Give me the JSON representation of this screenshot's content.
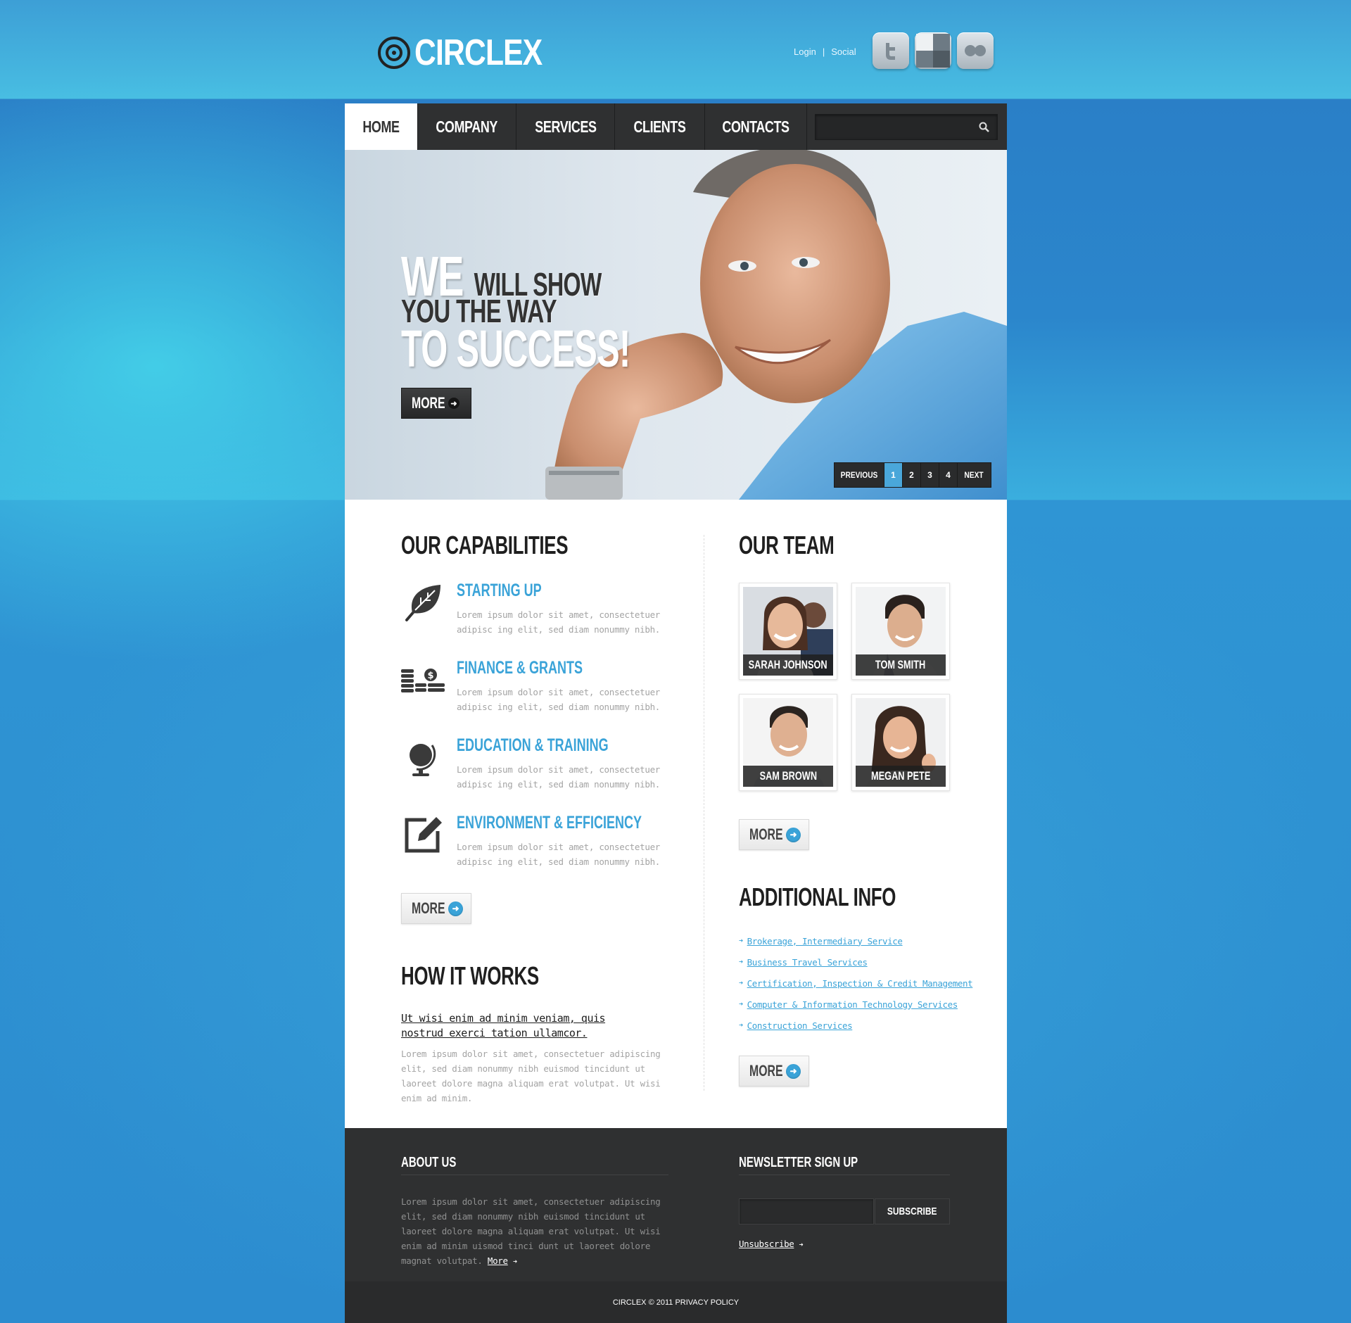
{
  "brand": {
    "name": "CIRCLEX"
  },
  "toplinks": {
    "login": "Login",
    "separator": "|",
    "social": "Social"
  },
  "social_icons": [
    "twitter-icon",
    "delicious-icon",
    "flickr-icon"
  ],
  "nav": {
    "items": [
      {
        "label": "HOME",
        "active": true
      },
      {
        "label": "COMPANY"
      },
      {
        "label": "SERVICES"
      },
      {
        "label": "CLIENTS"
      },
      {
        "label": "CONTACTS"
      }
    ],
    "search_placeholder": ""
  },
  "hero": {
    "line1_big": "WE",
    "line1_small": "WILL SHOW",
    "line2": "YOU THE WAY",
    "line3": "TO SUCCESS!",
    "more_label": "MORE",
    "pager": {
      "previous": "PREVIOUS",
      "pages": [
        "1",
        "2",
        "3",
        "4"
      ],
      "current": "1",
      "next": "NEXT"
    }
  },
  "capabilities": {
    "title": "OUR CAPABILITIES",
    "items": [
      {
        "icon": "leaf-icon",
        "title": "STARTING UP",
        "text": "Lorem ipsum dolor sit amet, consectetuer adipisc ing elit, sed diam nonummy nibh."
      },
      {
        "icon": "coins-icon",
        "title": "FINANCE & GRANTS",
        "text": "Lorem ipsum dolor sit amet, consectetuer adipisc ing elit, sed diam nonummy nibh."
      },
      {
        "icon": "globe-icon",
        "title": "EDUCATION & TRAINING",
        "text": "Lorem ipsum dolor sit amet, consectetuer adipisc ing elit, sed diam nonummy nibh."
      },
      {
        "icon": "edit-icon",
        "title": "ENVIRONMENT & EFFICIENCY",
        "text": "Lorem ipsum dolor sit amet, consectetuer adipisc ing elit, sed diam nonummy nibh."
      }
    ],
    "more_label": "MORE"
  },
  "how_it_works": {
    "title": "HOW IT WORKS",
    "link": "Ut wisi enim ad minim veniam, quis nostrud exerci tation ullamcor.",
    "text": "Lorem ipsum dolor sit amet, consectetuer adipiscing elit, sed diam nonummy nibh euismod tincidunt ut laoreet dolore magna aliquam erat volutpat. Ut wisi enim ad minim."
  },
  "team": {
    "title": "OUR TEAM",
    "members": [
      {
        "name": "SARAH JOHNSON"
      },
      {
        "name": "TOM SMITH"
      },
      {
        "name": "SAM BROWN"
      },
      {
        "name": "MEGAN PETE"
      }
    ],
    "more_label": "MORE"
  },
  "additional_info": {
    "title": "ADDITIONAL INFO",
    "links": [
      "Brokerage, Intermediary Service",
      "Business Travel Services",
      "Certification, Inspection & Credit Management",
      "Computer & Information Technology Services",
      "Construction Services"
    ],
    "more_label": "MORE"
  },
  "footer": {
    "about_title": "ABOUT US",
    "about_text": "Lorem ipsum dolor sit amet, consectetuer adipiscing elit, sed diam nonummy nibh euismod tincidunt ut laoreet dolore magna aliquam erat volutpat. Ut wisi enim ad minim uismod tinci dunt ut laoreet dolore magnat volutpat.",
    "about_more": "More",
    "newsletter_title": "NEWSLETTER SIGN UP",
    "subscribe_label": "SUBSCRIBE",
    "email_placeholder": "",
    "unsubscribe": "Unsubscribe",
    "copyright": "CIRCLEX © 2011 PRIVACY POLICY"
  },
  "colors": {
    "accent": "#3aa3d8",
    "dark": "#2f3031",
    "background": "#2c8ccf"
  }
}
